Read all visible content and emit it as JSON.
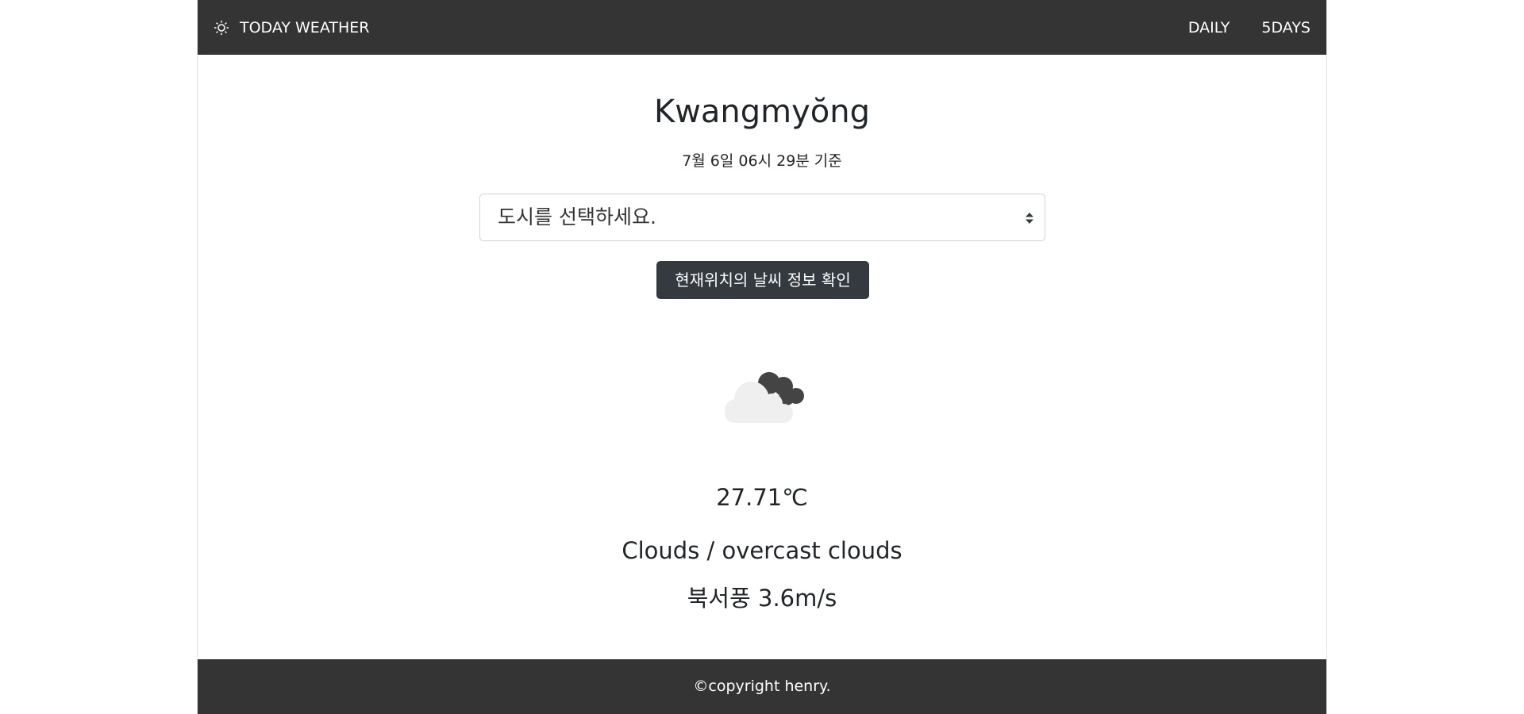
{
  "navbar": {
    "brand_icon": "sun-icon",
    "brand": "TODAY WEATHER",
    "links": [
      {
        "label": "DAILY"
      },
      {
        "label": "5DAYS"
      }
    ]
  },
  "main": {
    "city": "Kwangmyŏng",
    "timestamp": "7월 6일 06시 29분 기준",
    "city_select": {
      "selected": "도시를 선택하세요."
    },
    "location_button": "현재위치의 날씨 정보 확인",
    "weather_icon": "overcast-clouds-icon",
    "temperature": "27.71℃",
    "description": "Clouds / overcast clouds",
    "wind": "북서풍 3.6m/s"
  },
  "footer": {
    "text": "©copyright henry."
  },
  "colors": {
    "nav_bg": "#343434",
    "button_bg": "#343a40",
    "cloud_light": "#f0f0f0",
    "cloud_dark": "#444444"
  }
}
